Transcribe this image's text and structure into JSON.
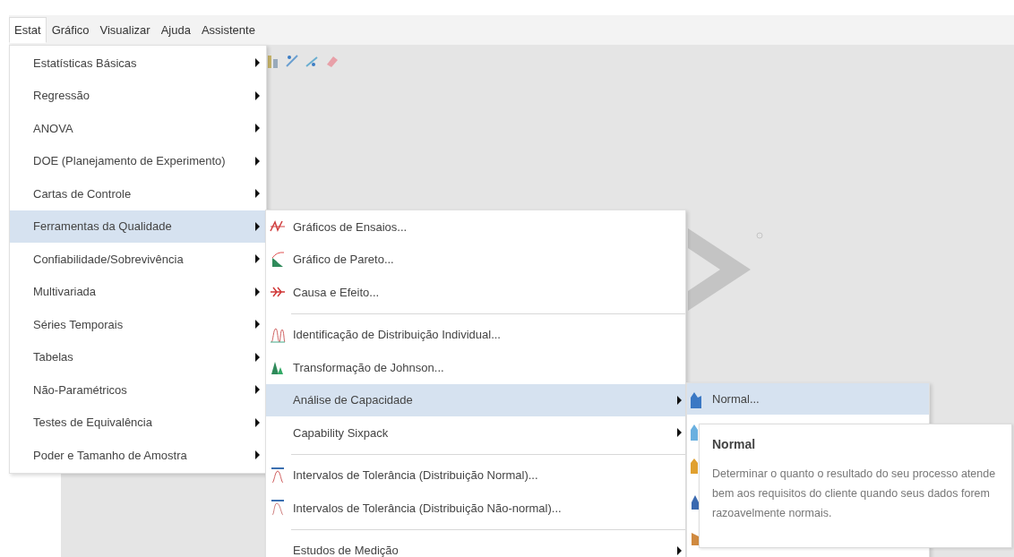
{
  "menubar": [
    {
      "label": "Estat",
      "selected": true
    },
    {
      "label": "Gráfico",
      "selected": false
    },
    {
      "label": "Visualizar",
      "selected": false
    },
    {
      "label": "Ajuda",
      "selected": false
    },
    {
      "label": "Assistente",
      "selected": false
    }
  ],
  "stat_menu": [
    {
      "label": "Estatísticas Básicas",
      "selected": false
    },
    {
      "label": "Regressão",
      "selected": false
    },
    {
      "label": "ANOVA",
      "selected": false
    },
    {
      "label": "DOE (Planejamento de Experimento)",
      "selected": false
    },
    {
      "label": "Cartas de Controle",
      "selected": false
    },
    {
      "label": "Ferramentas da Qualidade",
      "selected": true
    },
    {
      "label": "Confiabilidade/Sobrevivência",
      "selected": false
    },
    {
      "label": "Multivariada",
      "selected": false
    },
    {
      "label": "Séries Temporais",
      "selected": false
    },
    {
      "label": "Tabelas",
      "selected": false
    },
    {
      "label": "Não-Paramétricos",
      "selected": false
    },
    {
      "label": "Testes de Equivalência",
      "selected": false
    },
    {
      "label": "Poder e Tamanho de Amostra",
      "selected": false
    }
  ],
  "quality_menu": [
    {
      "kind": "tool",
      "label": "Gráficos de Ensaios...",
      "selected": false
    },
    {
      "kind": "tool",
      "label": "Gráfico de Pareto...",
      "selected": false
    },
    {
      "kind": "tool",
      "label": "Causa e Efeito...",
      "selected": false
    },
    {
      "kind": "separator"
    },
    {
      "kind": "tool",
      "label": "Identificação de Distribuição Individual...",
      "selected": false
    },
    {
      "kind": "tool",
      "label": "Transformação de Johnson...",
      "selected": false
    },
    {
      "kind": "submenu",
      "label": "Análise de Capacidade",
      "selected": true
    },
    {
      "kind": "submenu",
      "label": "Capability Sixpack",
      "selected": false
    },
    {
      "kind": "separator"
    },
    {
      "kind": "tool",
      "label": "Intervalos de Tolerância (Distribuição Normal)...",
      "selected": false
    },
    {
      "kind": "tool",
      "label": "Intervalos de Tolerância (Distribuição Não-normal)...",
      "selected": false
    },
    {
      "kind": "separator"
    },
    {
      "kind": "submenu",
      "label": "Estudos de Medição",
      "selected": false
    }
  ],
  "capability_menu": [
    {
      "label": "Normal...",
      "selected": true
    }
  ],
  "tooltip": {
    "title": "Normal",
    "text": "Determinar o quanto o resultado do seu processo atende bem aos requisitos do cliente quando seus dados forem razoavelmente normais."
  }
}
